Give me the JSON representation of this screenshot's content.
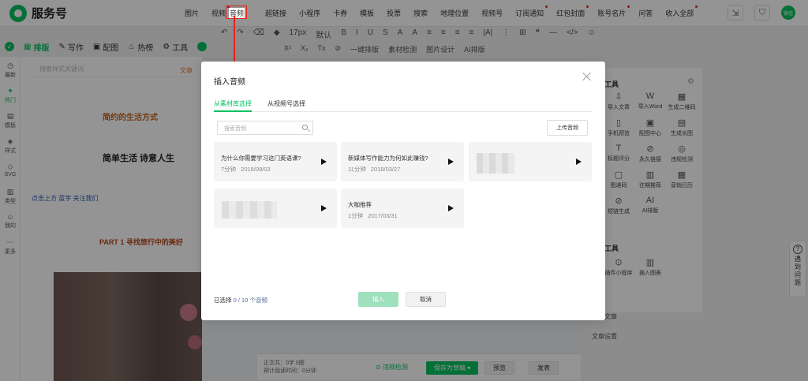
{
  "app": {
    "name": "服务号"
  },
  "top_menu": [
    {
      "label": "图片",
      "caret": true
    },
    {
      "label": "视频"
    },
    {
      "label": "音频",
      "highlighted": true
    },
    {
      "label": "超链接"
    },
    {
      "label": "小程序"
    },
    {
      "label": "卡券"
    },
    {
      "label": "模板"
    },
    {
      "label": "投票"
    },
    {
      "label": "搜索"
    },
    {
      "label": "地理位置"
    },
    {
      "label": "视频号"
    },
    {
      "label": "订阅通知"
    },
    {
      "label": "红包封面"
    },
    {
      "label": "账号名片"
    },
    {
      "label": "问答"
    },
    {
      "label": "收入全部"
    }
  ],
  "user": {
    "avatar_text": "微信"
  },
  "left_tabs": [
    {
      "label": "排版",
      "active": true
    },
    {
      "label": "写作"
    },
    {
      "label": "配图"
    },
    {
      "label": "热榜"
    },
    {
      "label": "工具"
    }
  ],
  "toolbar": {
    "row1": [
      "↶",
      "↷",
      "⌫",
      "◆",
      "17px",
      "默认",
      "B",
      "I",
      "U",
      "S",
      "A",
      "A",
      "≡",
      "≡",
      "≡",
      "≡",
      "|A|",
      "⋮",
      "⊞",
      "❝",
      "—",
      "</>",
      "☺"
    ],
    "row2": [
      "X²",
      "X₂",
      "Tx",
      "⊘",
      "一键排版",
      "素材检测",
      "图片设计",
      "AI排版"
    ]
  },
  "left_rail": [
    {
      "label": "最新"
    },
    {
      "label": "热门",
      "active": true
    },
    {
      "label": "模板"
    },
    {
      "label": "样式"
    },
    {
      "label": "SVG"
    },
    {
      "label": "类型"
    },
    {
      "label": "我的"
    },
    {
      "label": "更多"
    }
  ],
  "style_panel": {
    "search_placeholder": "搜索样式关键词",
    "right_tag": "文章",
    "templates": [
      "简约的生活方式",
      "简单生活 诗意人生",
      "点击上方 蓝字 关注我们",
      "PART 1 寻找旅行中的美好"
    ]
  },
  "right_panel": {
    "section1": "常用工具",
    "tools": [
      {
        "icon": "⇩",
        "label": "导入文章"
      },
      {
        "icon": "W",
        "label": "导入Word"
      },
      {
        "icon": "▦",
        "label": "生成二维码"
      },
      {
        "icon": "▯",
        "label": "手机预览"
      },
      {
        "icon": "▣",
        "label": "配图中心"
      },
      {
        "icon": "▤",
        "label": "生成长图"
      },
      {
        "icon": "T",
        "label": "标题评分"
      },
      {
        "icon": "⊘",
        "label": "永久链接"
      },
      {
        "icon": "◎",
        "label": "违规检测"
      },
      {
        "icon": "▢",
        "label": "图递码"
      },
      {
        "icon": "▥",
        "label": "往期推荐"
      },
      {
        "icon": "▦",
        "label": "营销日历"
      },
      {
        "icon": "⊘",
        "label": "短链生成"
      },
      {
        "icon": "AI",
        "label": "AI排版"
      }
    ],
    "section2": "推荐工具",
    "tools2": [
      {
        "icon": "⊙",
        "label": "插件小程序"
      },
      {
        "icon": "▥",
        "label": "插入图表"
      }
    ],
    "links": [
      "编辑文章",
      "文章设置"
    ]
  },
  "help": {
    "label": "遇到问题"
  },
  "footer": {
    "stats_line1": "正文共：0字 0图",
    "stats_line2": "预计阅读时间：0分钟",
    "check_label": "违规检测",
    "save_label": "保存为草稿",
    "preview_label": "预览",
    "publish_label": "发表"
  },
  "dialog": {
    "title": "插入音频",
    "tabs": [
      {
        "label": "从素材库选择",
        "active": true
      },
      {
        "label": "从视频号选择"
      }
    ],
    "search_placeholder": "搜索音频",
    "upload_label": "上传音频",
    "items": [
      {
        "title": "为什么你需要学习这门英语课?",
        "duration": "7分钟",
        "date": "2018/09/03"
      },
      {
        "title": "新媒体写作能力为何如此赚钱?",
        "duration": "11分钟",
        "date": "2018/03/27"
      },
      {
        "title": "",
        "duration": "",
        "date": "",
        "blurred": true
      },
      {
        "title": "",
        "duration": "",
        "date": "",
        "blurred": true
      },
      {
        "title": "大咖推荐",
        "duration": "1分钟",
        "date": "2017/03/31"
      }
    ],
    "selected_prefix": "已选择",
    "selected_count": "0 / 10 个音频",
    "insert_label": "插入",
    "cancel_label": "取消"
  },
  "colors": {
    "brand": "#07c160",
    "annotation": "#e2231a",
    "link": "#576b95"
  }
}
